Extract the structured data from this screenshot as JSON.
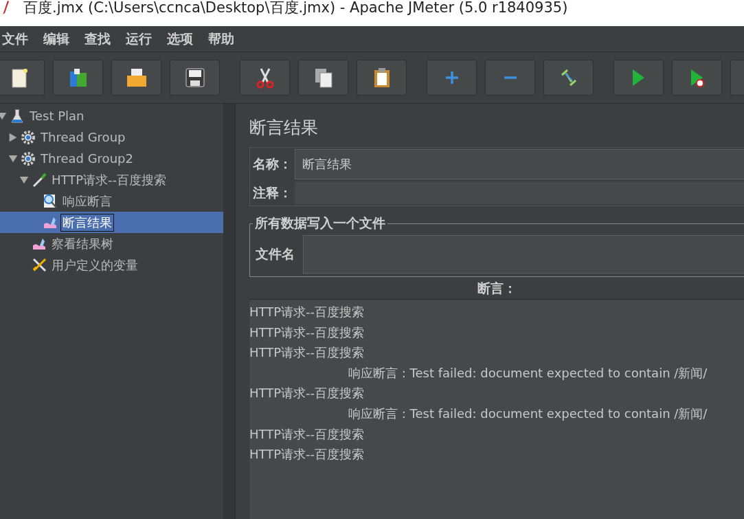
{
  "window": {
    "title": "百度.jmx (C:\\Users\\ccnca\\Desktop\\百度.jmx) - Apache JMeter (5.0 r1840935)"
  },
  "menu": [
    "文件",
    "编辑",
    "查找",
    "运行",
    "选项",
    "帮助"
  ],
  "toolbar": [
    {
      "buttons": [
        {
          "kind": "new"
        },
        {
          "kind": "templates"
        },
        {
          "kind": "open"
        },
        {
          "kind": "save"
        }
      ]
    },
    {
      "buttons": [
        {
          "kind": "cut"
        },
        {
          "kind": "copy"
        },
        {
          "kind": "paste"
        }
      ]
    },
    {
      "buttons": [
        {
          "kind": "expand"
        },
        {
          "kind": "collapse"
        },
        {
          "kind": "toggle"
        }
      ]
    },
    {
      "buttons": [
        {
          "kind": "start"
        },
        {
          "kind": "start-no-pause"
        },
        {
          "kind": "toolbar"
        }
      ]
    }
  ],
  "tree": [
    {
      "label": "Test Plan",
      "kind": "test-plan",
      "expanded": true,
      "selected": false,
      "children": [
        {
          "label": "Thread Group",
          "kind": "thread-group",
          "expanded": false,
          "selected": false
        },
        {
          "label": "Thread Group2",
          "kind": "thread-group",
          "expanded": true,
          "selected": false,
          "children": [
            {
              "label": "HTTP请求--百度搜索",
              "kind": "sampler",
              "expanded": true,
              "selected": false,
              "children": [
                {
                  "label": "响应断言",
                  "kind": "assertion",
                  "selected": false
                },
                {
                  "label": "断言结果",
                  "kind": "listener",
                  "selected": true
                }
              ]
            },
            {
              "label": "察看结果树",
              "kind": "listener",
              "selected": false
            },
            {
              "label": "用户定义的变量",
              "kind": "config",
              "selected": false
            }
          ]
        }
      ]
    }
  ],
  "panel": {
    "title": "断言结果",
    "name_label": "名称：",
    "name_value": "断言结果",
    "comment_label": "注释：",
    "file_group": "所有数据写入一个文件",
    "file_label": "文件名",
    "assertions_label": "断言：",
    "assertions": [
      {
        "kind": "sample",
        "text": "HTTP请求--百度搜索"
      },
      {
        "kind": "sample",
        "text": "HTTP请求--百度搜索"
      },
      {
        "kind": "sample",
        "text": "HTTP请求--百度搜索"
      },
      {
        "kind": "failure",
        "text": "响应断言 : Test failed: document expected to contain /新闻/"
      },
      {
        "kind": "sample",
        "text": "HTTP请求--百度搜索"
      },
      {
        "kind": "failure",
        "text": "响应断言 : Test failed: document expected to contain /新闻/"
      },
      {
        "kind": "sample",
        "text": "HTTP请求--百度搜索"
      },
      {
        "kind": "sample",
        "text": "HTTP请求--百度搜索"
      }
    ]
  }
}
